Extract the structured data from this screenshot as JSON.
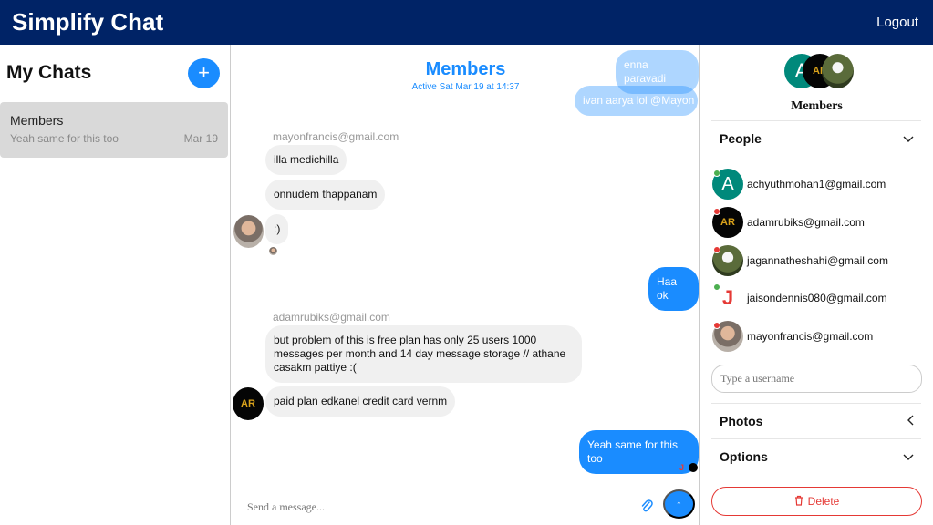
{
  "app": {
    "title": "Simplify Chat",
    "logout_label": "Logout"
  },
  "left": {
    "title": "My Chats",
    "add_icon": "plus-icon",
    "chats": [
      {
        "name": "Members",
        "preview": "Yeah same for this too",
        "date": "Mar 19"
      }
    ]
  },
  "conversation": {
    "title": "Members",
    "status": "Active Sat Mar 19 at 14:37",
    "faded_out_1": "enna paravadi",
    "faded_out_2": "ivan aarya lol @Mayon",
    "sender_1": "mayonfrancis@gmail.com",
    "msg_1": "illa medichilla",
    "msg_2": "onnudem thappanam",
    "msg_3": ":)",
    "msg_4": "Haa ok",
    "sender_2": "adamrubiks@gmail.com",
    "msg_5": "but problem of this is free plan has only 25 users 1000 messages per month and 14 day message storage // athane casakm pattiye :(",
    "msg_6": "paid plan edkanel credit card vernm",
    "msg_7": "Yeah same for this too",
    "composer_placeholder": "Send a message...",
    "attach_icon": "paperclip-icon",
    "send_icon": "arrow-up-icon"
  },
  "details": {
    "group_name": "Members",
    "people_label": "People",
    "people": [
      {
        "email": "achyuthmohan1@gmail.com",
        "status_color": "#4caf50",
        "avatar": "A"
      },
      {
        "email": "adamrubiks@gmail.com",
        "status_color": "#e53935",
        "avatar": "AR"
      },
      {
        "email": "jagannatheshahi@gmail.com",
        "status_color": "#e53935",
        "avatar": ""
      },
      {
        "email": "jaisondennis080@gmail.com",
        "status_color": "#4caf50",
        "avatar": "J"
      },
      {
        "email": "mayonfrancis@gmail.com",
        "status_color": "#e53935",
        "avatar": ""
      }
    ],
    "username_placeholder": "Type a username",
    "photos_label": "Photos",
    "options_label": "Options",
    "delete_label": "Delete",
    "delete_icon": "trash-icon"
  },
  "colors": {
    "header": "#002366",
    "accent": "#1a8cff",
    "danger": "#e53935",
    "online": "#4caf50"
  }
}
